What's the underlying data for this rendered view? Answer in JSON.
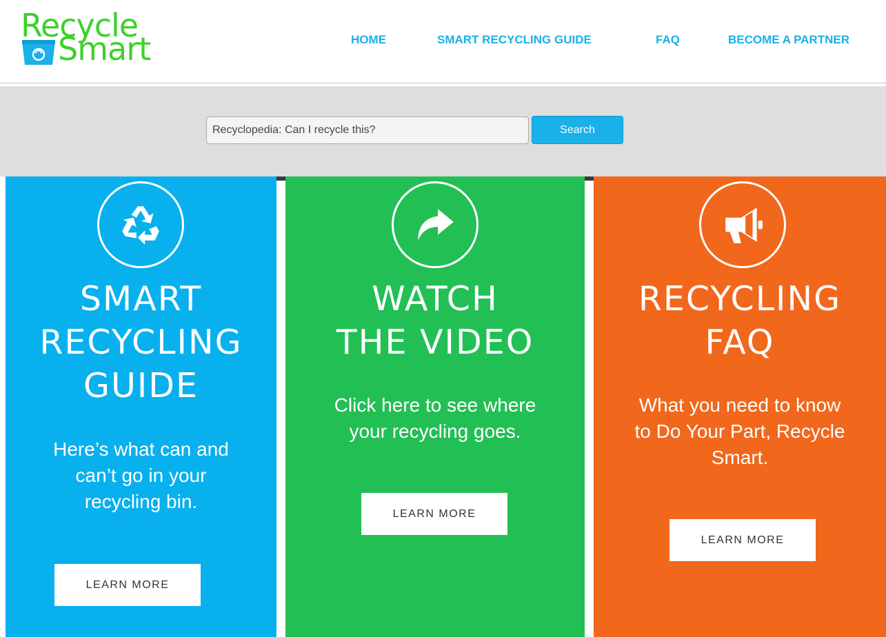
{
  "brand": {
    "logo_line1": "Recycle",
    "logo_line2": "Smart",
    "color_green": "#3cd12a",
    "color_blue": "#1ab0e8"
  },
  "nav": {
    "items": [
      {
        "label": "HOME"
      },
      {
        "label": "SMART RECYCLING GUIDE"
      },
      {
        "label": "FAQ"
      },
      {
        "label": "BECOME A PARTNER"
      }
    ]
  },
  "search": {
    "placeholder": "Recyclopedia: Can I recycle this?",
    "value": "",
    "button_label": "Search"
  },
  "panels": [
    {
      "icon": "recycle-icon",
      "title": "SMART\nRECYCLING\nGUIDE",
      "description": "Here’s what can and\ncan’t go in your\nrecycling bin.",
      "button_label": "LEARN MORE",
      "color": "#08b0ee"
    },
    {
      "icon": "share-arrow-icon",
      "title": "WATCH\nTHE VIDEO",
      "description": "Click here to see where\nyour recycling goes.",
      "button_label": "LEARN MORE",
      "color": "#22bf55"
    },
    {
      "icon": "megaphone-icon",
      "title": "RECYCLING\nFAQ",
      "description": "What you need to know\nto Do Your Part, Recycle\nSmart.",
      "button_label": "LEARN MORE",
      "color": "#f1671c"
    }
  ]
}
